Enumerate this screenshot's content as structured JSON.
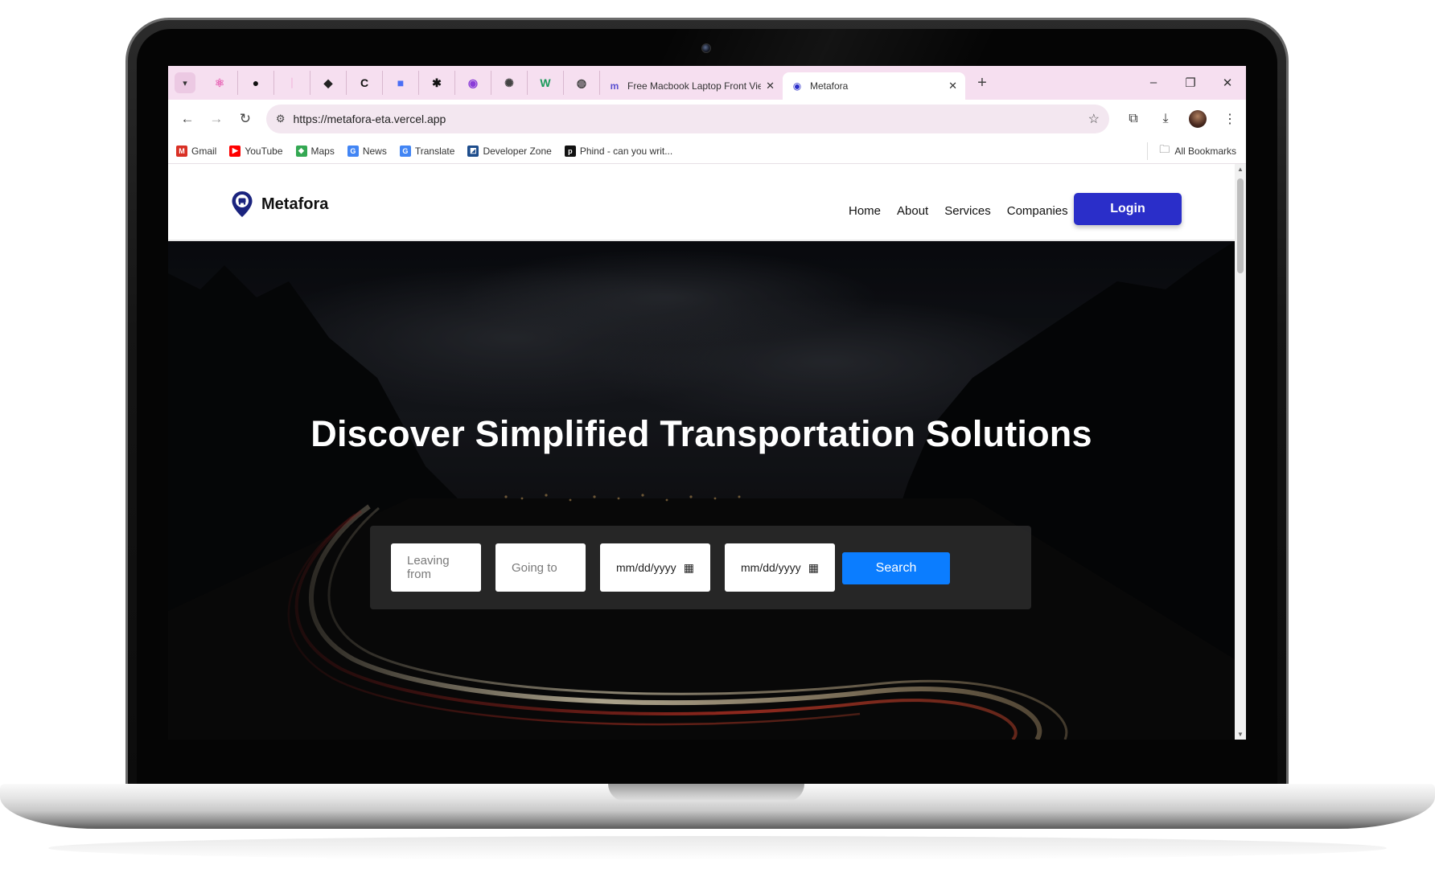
{
  "browser": {
    "tabs": {
      "menu_icon": "chevron-down-icon",
      "pinned": [
        {
          "icon": "react-icon",
          "glyph": "⚛",
          "color": "#e86ab8"
        },
        {
          "icon": "github-icon",
          "glyph": "●",
          "color": "#111111"
        },
        {
          "icon": "pink-logo-icon",
          "glyph": "ᛁ",
          "color": "#f3b6dc"
        },
        {
          "icon": "profile-icon",
          "glyph": "◆",
          "color": "#222222"
        },
        {
          "icon": "c-logo-icon",
          "glyph": "C",
          "color": "#111111"
        },
        {
          "icon": "colorful-blocks-icon",
          "glyph": "■",
          "color": "#4a6ef5"
        },
        {
          "icon": "openai-icon",
          "glyph": "✱",
          "color": "#111111"
        },
        {
          "icon": "purple-circle-icon",
          "glyph": "◉",
          "color": "#8a3bd8"
        },
        {
          "icon": "chatgpt-icon",
          "glyph": "✺",
          "color": "#444444"
        },
        {
          "icon": "w-logo-icon",
          "glyph": "W",
          "color": "#1a9a5a"
        },
        {
          "icon": "globe-icon",
          "glyph": "◍",
          "color": "#444444"
        }
      ],
      "inactive_tab_title": "Free Macbook Laptop Front View",
      "active_tab_title": "Metafora",
      "new_tab": "+",
      "minimize": "–",
      "restore": "❐",
      "close": "✕"
    },
    "address": {
      "url": "https://metafora-eta.vercel.app"
    },
    "bookmarks": [
      {
        "label": "Gmail",
        "icon": "gmail-icon",
        "glyph": "M",
        "color": "#d93025"
      },
      {
        "label": "YouTube",
        "icon": "youtube-icon",
        "glyph": "▶",
        "color": "#ff0000"
      },
      {
        "label": "Maps",
        "icon": "maps-icon",
        "glyph": "◆",
        "color": "#34a853"
      },
      {
        "label": "News",
        "icon": "news-icon",
        "glyph": "G",
        "color": "#4285f4"
      },
      {
        "label": "Translate",
        "icon": "translate-icon",
        "glyph": "G",
        "color": "#4285f4"
      },
      {
        "label": "Developer Zone",
        "icon": "developer-zone-icon",
        "glyph": "◩",
        "color": "#1e4d8c"
      },
      {
        "label": "Phind - can you writ...",
        "icon": "phind-icon",
        "glyph": "p",
        "color": "#111111"
      }
    ],
    "all_bookmarks": "All Bookmarks"
  },
  "site": {
    "brand": "Metafora",
    "nav": [
      "Home",
      "About",
      "Services",
      "Companies"
    ],
    "login": "Login",
    "hero_title": "Discover Simplified Transportation Solutions",
    "search": {
      "leaving_placeholder": "Leaving from",
      "going_placeholder": "Going to",
      "depart_date": "mm/dd/yyyy",
      "return_date": "mm/dd/yyyy",
      "button": "Search"
    }
  },
  "colors": {
    "tab_strip": "#f6dff0",
    "login_button": "#2a2ec9",
    "search_button": "#0b7dff",
    "brand_pin": "#1a237e"
  }
}
